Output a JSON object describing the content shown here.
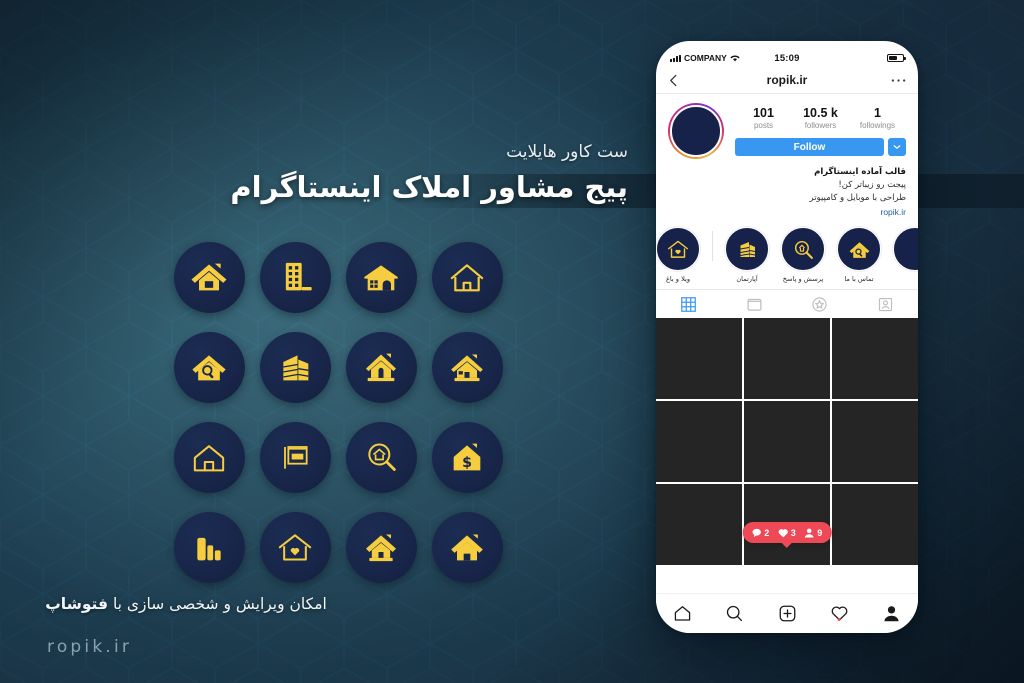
{
  "poster": {
    "subtitle": "ست کاور هایلایت",
    "title": "پیج مشاور املاک اینستاگرام",
    "caption_prefix": "امکان ویرایش و شخصی سازی با ",
    "caption_bold": "فتوشاپ",
    "watermark": "ropik.ir"
  },
  "icon_grid": {
    "items": [
      {
        "name": "house-roof-filled-icon"
      },
      {
        "name": "apartment-building-icon"
      },
      {
        "name": "barn-cottage-icon"
      },
      {
        "name": "house-outline-icon"
      },
      {
        "name": "house-search-icon"
      },
      {
        "name": "skyscraper-icon"
      },
      {
        "name": "house-door-icon"
      },
      {
        "name": "house-door-window-icon"
      },
      {
        "name": "home-line-icon"
      },
      {
        "name": "for-rent-sign-icon"
      },
      {
        "name": "magnifier-house-icon"
      },
      {
        "name": "house-dollar-icon"
      },
      {
        "name": "bar-chart-icon"
      },
      {
        "name": "house-heart-icon"
      },
      {
        "name": "house-solid-door-icon"
      },
      {
        "name": "house-simple-filled-icon"
      }
    ],
    "circle_color": "#18264a",
    "icon_color": "#f5cd3f"
  },
  "phone": {
    "status_bar": {
      "carrier": "COMPANY",
      "time": "15:09"
    },
    "app_bar": {
      "title": "ropik.ir",
      "back_icon": "chevron-left-icon",
      "more_icon": "more-options-icon"
    },
    "profile": {
      "stats": [
        {
          "value": "101",
          "label": "posts"
        },
        {
          "value": "10.5 k",
          "label": "followers"
        },
        {
          "value": "1",
          "label": "followings"
        }
      ],
      "follow_label": "Follow",
      "caret_icon": "chevron-down-icon",
      "accent_color": "#3897f0"
    },
    "bio": {
      "name": "قالب آماده اینستاگرام",
      "line1": "پیجت رو زیباتر کن!",
      "line2": "طراحی با موبایل و کامپیوتر",
      "link": "ropik.ir"
    },
    "highlights": [
      {
        "label": "ویلا و باغ",
        "icon": "house-heart-icon"
      },
      {
        "label": "آپارتمان",
        "icon": "buildings-stack-icon"
      },
      {
        "label": "پرسش و پاسخ",
        "icon": "magnifier-question-icon"
      },
      {
        "label": "تماس با ما",
        "icon": "house-search-icon"
      },
      {
        "label": "",
        "icon": "highlight-partial-icon"
      }
    ],
    "tabs": [
      {
        "name": "grid-tab",
        "icon": "grid-icon",
        "active": true
      },
      {
        "name": "reels-tab",
        "icon": "tv-icon",
        "active": false
      },
      {
        "name": "guides-tab",
        "icon": "star-icon",
        "active": false
      },
      {
        "name": "tagged-tab",
        "icon": "tagged-person-icon",
        "active": false
      }
    ],
    "grid_tiles": 9,
    "notifications": {
      "comments": "2",
      "likes": "3",
      "followers": "9",
      "badge_color": "#ed4956"
    },
    "bottom_nav": [
      {
        "name": "home-nav",
        "icon": "home-icon"
      },
      {
        "name": "search-nav",
        "icon": "search-icon"
      },
      {
        "name": "add-post-nav",
        "icon": "plus-square-icon"
      },
      {
        "name": "activity-nav",
        "icon": "heart-icon"
      },
      {
        "name": "profile-nav",
        "icon": "person-icon"
      }
    ]
  }
}
